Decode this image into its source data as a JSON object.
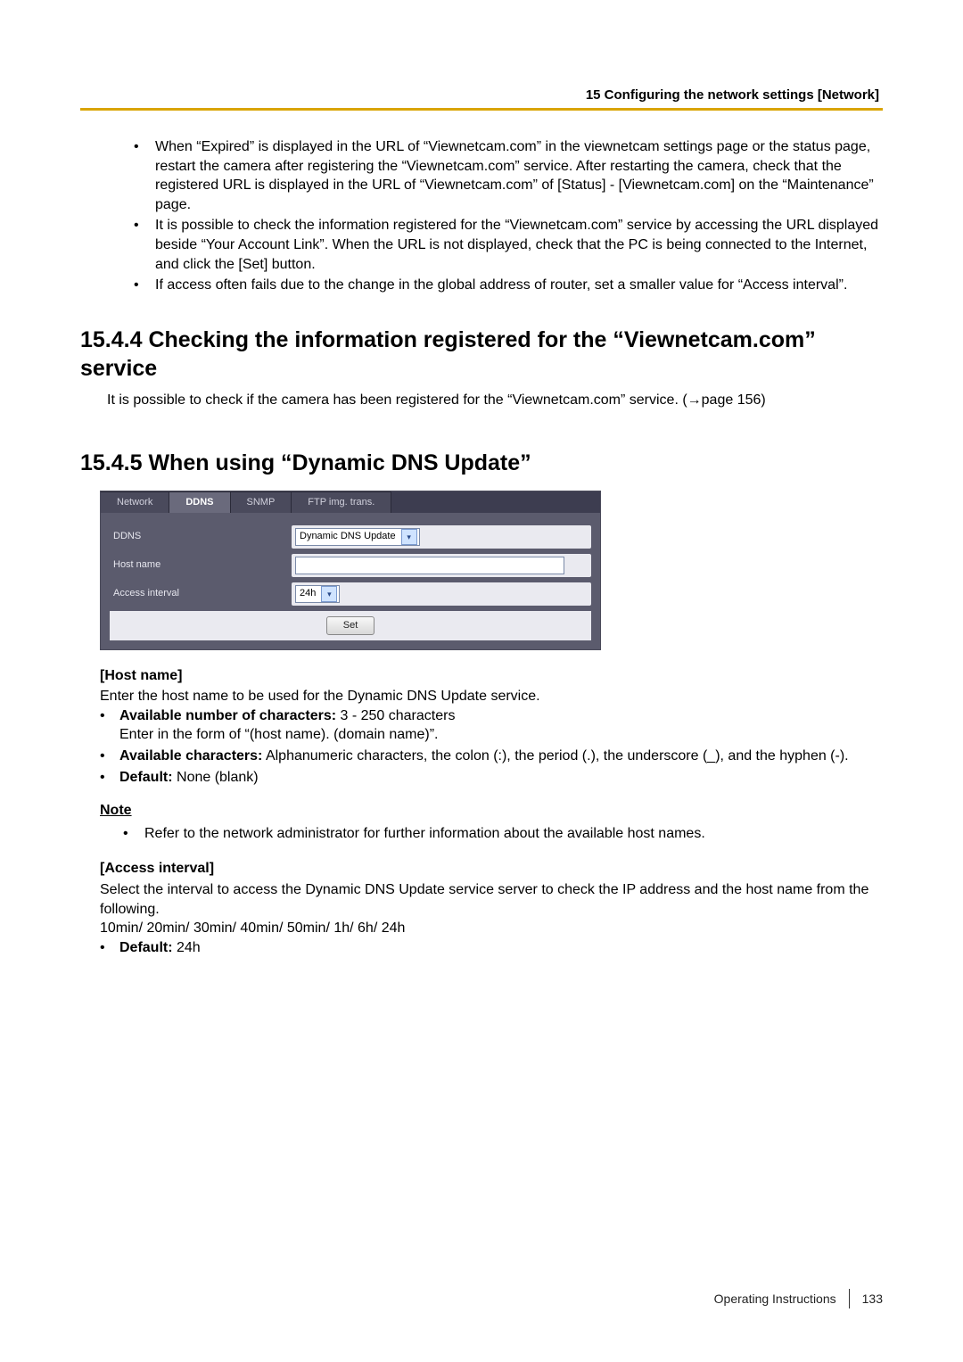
{
  "header": {
    "chapter": "15 Configuring the network settings [Network]"
  },
  "intro_bullets": [
    "When “Expired” is displayed in the URL of “Viewnetcam.com” in the viewnetcam settings page or the status page, restart the camera after registering the “Viewnetcam.com” service. After restarting the camera, check that the registered URL is displayed in the URL of “Viewnetcam.com” of [Status] - [Viewnetcam.com] on the “Maintenance” page.",
    "It is possible to check the information registered for the “Viewnetcam.com” service by accessing the URL displayed beside “Your Account Link”. When the URL is not displayed, check that the PC is being connected to the Internet, and click the [Set] button.",
    "If access often fails due to the change in the global address of router, set a smaller value for “Access interval”."
  ],
  "section_1544": {
    "title": "15.4.4  Checking the information registered for the “Viewnetcam.com” service",
    "para": "It is possible to check if the camera has been registered for the “Viewnetcam.com” service. (→page 156)"
  },
  "section_1545": {
    "title": "15.4.5  When using “Dynamic DNS Update”"
  },
  "ui": {
    "tabs": {
      "network": "Network",
      "ddns": "DDNS",
      "snmp": "SNMP",
      "ftp": "FTP img. trans."
    },
    "labels": {
      "ddns": "DDNS",
      "hostname": "Host name",
      "interval": "Access interval"
    },
    "values": {
      "ddns_select": "Dynamic DNS Update",
      "interval_select": "24h"
    },
    "set_button": "Set"
  },
  "hostname": {
    "head": "[Host name]",
    "desc": "Enter the host name to be used for the Dynamic DNS Update service.",
    "b1_label": "Available number of characters:",
    "b1_rest": " 3 - 250 characters",
    "b1_line2": "Enter in the form of “(host name). (domain name)”.",
    "b2_label": "Available characters:",
    "b2_rest": " Alphanumeric characters, the colon (:), the period (.), the underscore (_), and the hyphen (-).",
    "b3_label": "Default:",
    "b3_rest": " None (blank)"
  },
  "note": {
    "head": "Note",
    "text": "Refer to the network administrator for further information about the available host names."
  },
  "access_interval": {
    "head": "[Access interval]",
    "desc": "Select the interval to access the Dynamic DNS Update service server to check the IP address and the host name from the following.",
    "options": "10min/ 20min/ 30min/ 40min/ 50min/ 1h/ 6h/ 24h",
    "def_label": "Default:",
    "def_rest": " 24h"
  },
  "footer": {
    "doc": "Operating Instructions",
    "page": "133"
  }
}
